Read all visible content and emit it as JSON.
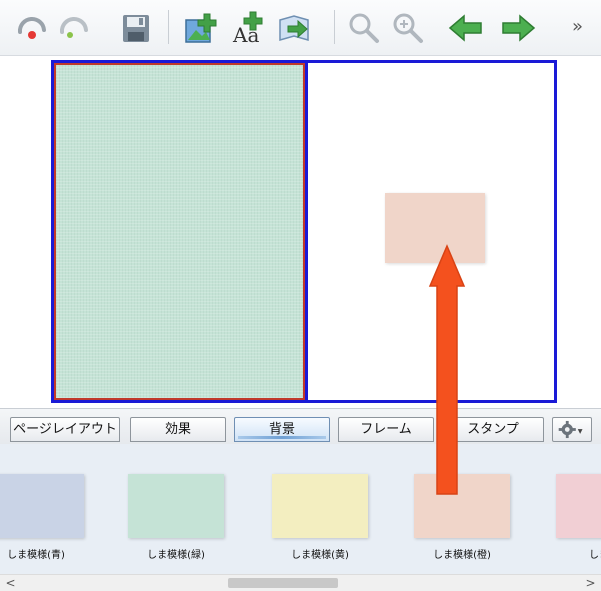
{
  "toolbar": {
    "buttons": [
      {
        "name": "undo-icon"
      },
      {
        "name": "redo-icon"
      },
      {
        "name": "save-icon"
      },
      {
        "name": "add-image-icon"
      },
      {
        "name": "add-text-icon"
      },
      {
        "name": "import-icon"
      },
      {
        "name": "zoom-out-icon"
      },
      {
        "name": "zoom-in-icon"
      },
      {
        "name": "arrow-left-icon"
      },
      {
        "name": "arrow-right-icon"
      }
    ],
    "more_label": "»"
  },
  "tabs": [
    {
      "label": "ページレイアウト",
      "active": false
    },
    {
      "label": "効果",
      "active": false
    },
    {
      "label": "背景",
      "active": true
    },
    {
      "label": "フレーム",
      "active": false
    },
    {
      "label": "スタンプ",
      "active": false
    }
  ],
  "gear_label": "▾",
  "backgrounds": [
    {
      "label": "しま模様(青)",
      "color": "#c9d3e6"
    },
    {
      "label": "しま模様(緑)",
      "color": "#c5e3d6"
    },
    {
      "label": "しま模様(黄)",
      "color": "#f3eec0"
    },
    {
      "label": "しま模様(橙)",
      "color": "#f0d5c9"
    },
    {
      "label": "しま模",
      "color": "#f1cfd4"
    }
  ],
  "colors": {
    "spread_border": "#1a1ad6",
    "selected_page_border": "#c0392b",
    "annotation_arrow": "#f4511e"
  },
  "scroll": {
    "left_label": "<",
    "right_label": ">"
  }
}
